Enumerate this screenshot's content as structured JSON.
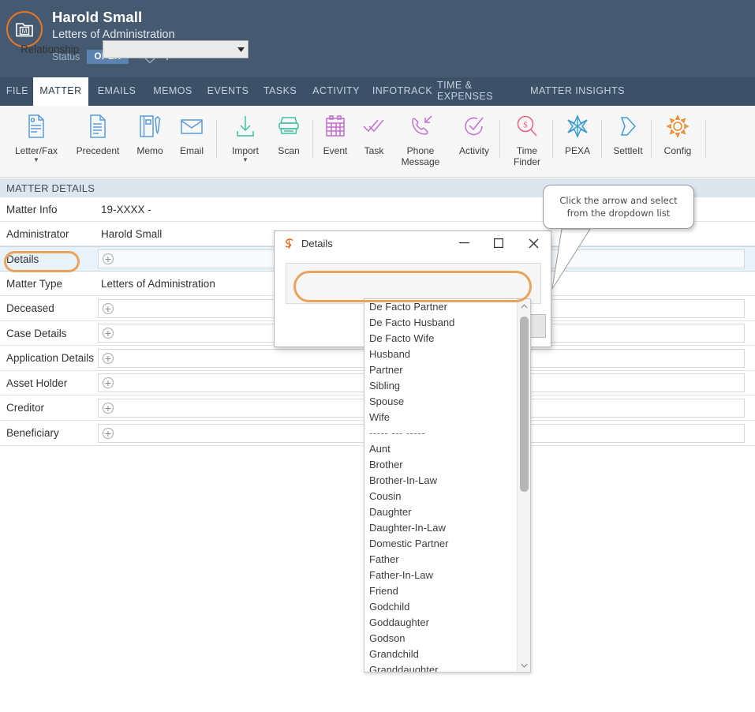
{
  "header": {
    "logo_icon": "matter-folder-icon",
    "title": "Harold Small",
    "subtitle": "Letters of Administration",
    "status_label": "Status",
    "status_value": "OPEN",
    "tag_icon": "tag-icon",
    "add_icon": "plus-icon",
    "bg_color": "#455a71",
    "accent_color": "#e87722"
  },
  "tabs": [
    {
      "label": "FILE",
      "active": false
    },
    {
      "label": "MATTER",
      "active": true
    },
    {
      "label": "EMAILS",
      "active": false
    },
    {
      "label": "MEMOS",
      "active": false
    },
    {
      "label": "EVENTS",
      "active": false
    },
    {
      "label": "TASKS",
      "active": false
    },
    {
      "label": "ACTIVITY",
      "active": false
    },
    {
      "label": "INFOTRACK",
      "active": false
    },
    {
      "label": "TIME & EXPENSES",
      "active": false
    },
    {
      "label": "MATTER INSIGHTS",
      "active": false
    }
  ],
  "ribbon": [
    {
      "label": "Letter/Fax",
      "icon": "letter-fax-icon",
      "color": "#5b9bd5",
      "caret": true
    },
    {
      "label": "Precedent",
      "icon": "precedent-document-icon",
      "color": "#5b9bd5",
      "caret": false
    },
    {
      "label": "Memo",
      "icon": "memo-notebook-icon",
      "color": "#5b9bd5",
      "caret": false
    },
    {
      "label": "Email",
      "icon": "email-envelope-icon",
      "color": "#5b9bd5",
      "caret": false
    },
    {
      "label": "Import",
      "icon": "import-download-icon",
      "color": "#3dc2a0",
      "caret": true
    },
    {
      "label": "Scan",
      "icon": "scanner-icon",
      "color": "#3dc2a0",
      "caret": false
    },
    {
      "label": "Event",
      "icon": "calendar-icon",
      "color": "#c36fd1",
      "caret": false
    },
    {
      "label": "Task",
      "icon": "task-checkmarks-icon",
      "color": "#c36fd1",
      "caret": false
    },
    {
      "label": "Phone Message",
      "icon": "phone-incoming-icon",
      "color": "#c36fd1",
      "caret": false
    },
    {
      "label": "Activity",
      "icon": "activity-check-circle-icon",
      "color": "#c36fd1",
      "caret": false
    },
    {
      "label": "Time Finder",
      "icon": "time-finder-dollar-search-icon",
      "color": "#e8607a",
      "caret": false
    },
    {
      "label": "PEXA",
      "icon": "pexa-star-icon",
      "color": "#3e9fd0",
      "caret": false
    },
    {
      "label": "SettleIt",
      "icon": "settleit-arrow-icon",
      "color": "#3e9fd0",
      "caret": false
    },
    {
      "label": "Config",
      "icon": "gear-icon",
      "color": "#e8892b",
      "caret": false
    }
  ],
  "matter_details": {
    "panel_title": "MATTER DETAILS",
    "rows": [
      {
        "label": "Matter Info",
        "value": "19-XXXX -",
        "type": "text",
        "highlight": false
      },
      {
        "label": "Administrator",
        "value": "Harold Small",
        "type": "text",
        "highlight": false
      },
      {
        "label": "Details",
        "value": "",
        "type": "add",
        "highlight": true
      },
      {
        "label": "Matter Type",
        "value": "Letters of Administration",
        "type": "text",
        "highlight": false
      },
      {
        "label": "Deceased",
        "value": "",
        "type": "add",
        "highlight": false
      },
      {
        "label": "Case Details",
        "value": "",
        "type": "add",
        "highlight": false
      },
      {
        "label": "Application Details",
        "value": "",
        "type": "add",
        "highlight": false
      },
      {
        "label": "Asset Holder",
        "value": "",
        "type": "add",
        "highlight": false
      },
      {
        "label": "Creditor",
        "value": "",
        "type": "add",
        "highlight": false
      },
      {
        "label": "Beneficiary",
        "value": "",
        "type": "add",
        "highlight": false
      }
    ],
    "add_icon": "plus-circle-icon"
  },
  "callout": {
    "line1": "Click the arrow and select",
    "line2": "from the dropdown list"
  },
  "dialog": {
    "icon": "smokeball-s-icon",
    "title": "Details",
    "minimize_label": "─",
    "maximize_label": "☐",
    "close_label": "✕",
    "field_label": "Relationship",
    "field_value": "",
    "dropdown_caret_icon": "chevron-down-icon"
  },
  "dropdown": {
    "items": [
      "De Facto Partner",
      "De Facto Husband",
      "De Facto Wife",
      "Husband",
      "Partner",
      "Sibling",
      "Spouse",
      "Wife",
      "----- --- -----",
      "Aunt",
      "Brother",
      "Brother-In-Law",
      "Cousin",
      "Daughter",
      "Daughter-In-Law",
      "Domestic Partner",
      "Father",
      "Father-In-Law",
      "Friend",
      "Godchild",
      "Goddaughter",
      "Godson",
      "Grandchild",
      "Granddaughter"
    ],
    "separator_index": 8,
    "scroll_up_icon": "chevron-up-icon",
    "scroll_down_icon": "chevron-down-icon"
  }
}
